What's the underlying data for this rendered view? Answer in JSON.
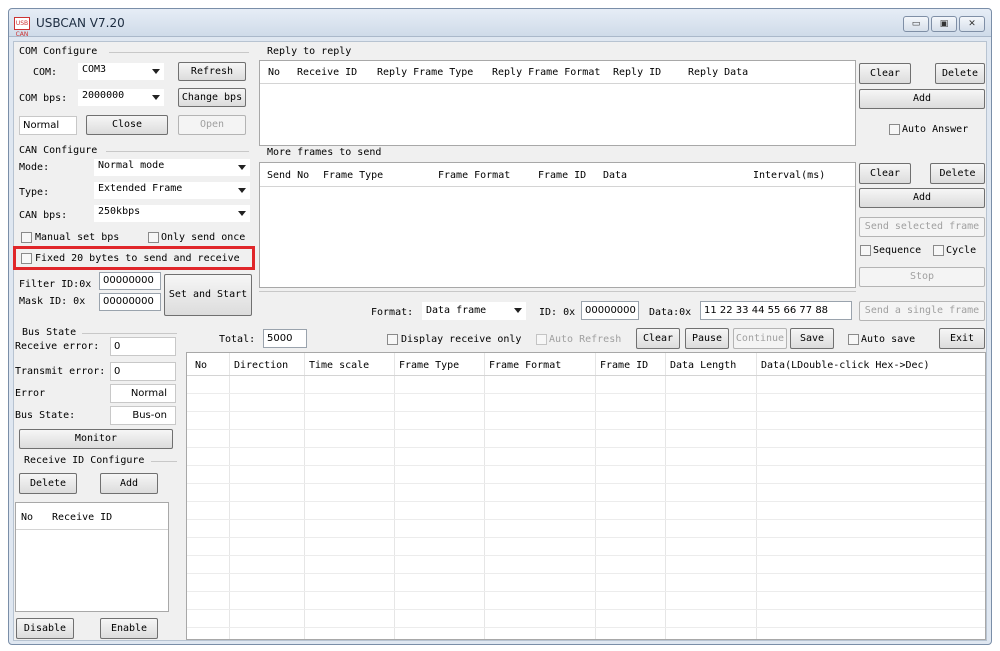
{
  "window": {
    "title": "USBCAN V7.20",
    "icon_text": "USB CAN"
  },
  "com": {
    "group": "COM Configure",
    "com_label": "COM:",
    "com_value": "COM3",
    "refresh": "Refresh",
    "bps_label": "COM bps:",
    "bps_value": "2000000",
    "change_bps": "Change bps",
    "state": "Normal",
    "close": "Close",
    "open": "Open"
  },
  "can": {
    "group": "CAN Configure",
    "mode_label": "Mode:",
    "mode_value": "Normal mode",
    "type_label": "Type:",
    "type_value": "Extended Frame",
    "bps_label": "CAN bps:",
    "bps_value": "250kbps",
    "manual_bps": "Manual set bps",
    "only_send_once": "Only send once",
    "fixed20": "Fixed 20 bytes to send and receive",
    "filter_label": "Filter ID:0x",
    "filter_value": "00000000",
    "mask_label": "Mask ID:  0x",
    "mask_value": "00000000",
    "set_start": "Set and Start"
  },
  "bus": {
    "group": "Bus State",
    "receive_error_label": "Receive error:",
    "receive_error": "0",
    "transmit_error_label": "Transmit error:",
    "transmit_error": "0",
    "error_label": "Error",
    "error_value": "Normal",
    "bus_state_label": "Bus State:",
    "bus_state_value": "Bus-on",
    "monitor": "Monitor"
  },
  "rid": {
    "group": "Receive ID Configure",
    "delete": "Delete",
    "add": "Add",
    "col_no": "No",
    "col_id": "Receive ID",
    "disable": "Disable",
    "enable": "Enable"
  },
  "reply": {
    "group": "Reply to reply",
    "cols": [
      "No",
      "Receive ID",
      "Reply Frame Type",
      "Reply Frame Format",
      "Reply  ID",
      "Reply Data"
    ],
    "clear": "Clear",
    "delete": "Delete",
    "add": "Add",
    "auto_answer": "Auto Answer"
  },
  "more": {
    "group": "More frames to send",
    "cols": [
      "Send No",
      "Frame Type",
      "Frame Format",
      "Frame ID",
      "Data",
      "Interval(ms)"
    ],
    "clear": "Clear",
    "delete": "Delete",
    "add": "Add",
    "send_selected": "Send selected frame",
    "sequence": "Sequence",
    "cycle": "Cycle",
    "stop": "Stop"
  },
  "send": {
    "format_label": "Format:",
    "format_value": "Data frame",
    "id_label": "ID: 0x",
    "id_value": "00000000",
    "data_label": "Data:0x",
    "data_value": "11 22 33 44 55 66 77 88",
    "send_single": "Send a single frame"
  },
  "log": {
    "total_label": "Total:",
    "total_value": "5000",
    "display_receive_only": "Display receive only",
    "auto_refresh": "Auto Refresh",
    "clear": "Clear",
    "pause": "Pause",
    "continue": "Continue",
    "save": "Save",
    "auto_save": "Auto save",
    "exit": "Exit",
    "cols": [
      "No",
      "Direction",
      "Time scale",
      "Frame Type",
      "Frame Format",
      "Frame ID",
      "Data Length",
      "Data(LDouble-click Hex->Dec)"
    ]
  },
  "colors": {
    "highlight": "#e0262a",
    "window_frame": "#dfe7f1"
  }
}
